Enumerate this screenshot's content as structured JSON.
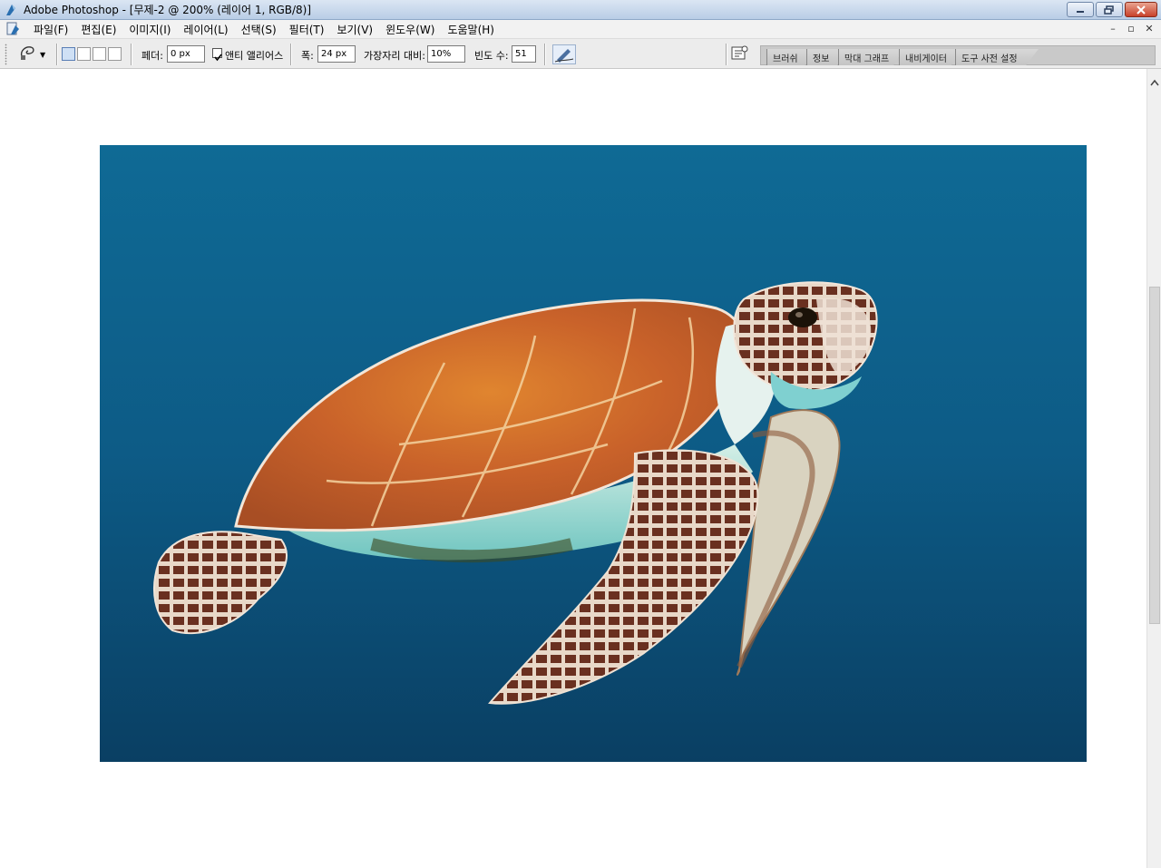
{
  "window": {
    "title": "Adobe Photoshop - [무제-2 @ 200% (레이어 1, RGB/8)]"
  },
  "menu": {
    "items": [
      "파일(F)",
      "편집(E)",
      "이미지(I)",
      "레이어(L)",
      "선택(S)",
      "필터(T)",
      "보기(V)",
      "윈도우(W)",
      "도움말(H)"
    ]
  },
  "options": {
    "feather_label": "페더:",
    "feather_value": "0 px",
    "antialias_label": "앤티 앨리어스",
    "antialias_checked": true,
    "width_label": "폭:",
    "width_value": "24 px",
    "contrast_label": "가장자리 대비:",
    "contrast_value": "10%",
    "frequency_label": "빈도 수:",
    "frequency_value": "51"
  },
  "palette_well": {
    "tabs": [
      "브러쉬",
      "정보",
      "막대 그래프",
      "내비게이터",
      "도구 사전 설정"
    ]
  },
  "icons": {
    "app": "photoshop-icon",
    "tool_preset": "magnetic-lasso-icon",
    "pen_pressure": "pen-pressure-icon",
    "palette_toggle": "palette-toggle-icon"
  },
  "canvas": {
    "image_subject": "sea turtle underwater",
    "background_color": "#0e5a83"
  }
}
